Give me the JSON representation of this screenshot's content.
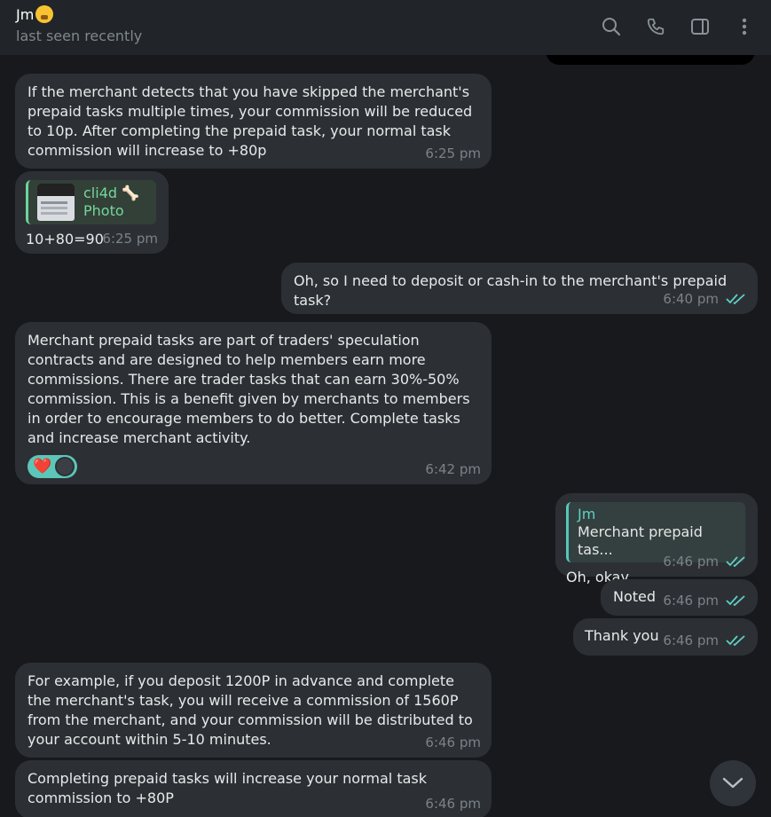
{
  "header": {
    "contact_name": "Jm",
    "status": "last seen recently",
    "icons": [
      "search-icon",
      "phone-icon",
      "sidebar-toggle-icon",
      "more-vertical-icon"
    ]
  },
  "colors": {
    "background": "#17191d",
    "header": "#212428",
    "bubble": "#2c3035",
    "read_check": "#5fd0c4",
    "reply_accent": "#6bd49a"
  },
  "messages": [
    {
      "direction": "incoming",
      "text": "If the merchant detects that you have skipped the merchant's prepaid tasks multiple times, your commission will be reduced to 10p. After completing the prepaid task, your normal task commission will increase to +80p",
      "time": "6:25 pm"
    },
    {
      "direction": "incoming",
      "reply": {
        "author": "cli4d 🦴",
        "preview": "Photo"
      },
      "text": "10+80=90",
      "time": "6:25 pm"
    },
    {
      "direction": "outgoing",
      "text": "Oh, so I need to deposit or cash-in to the merchant's prepaid task?",
      "time": "6:40 pm"
    },
    {
      "direction": "incoming",
      "text": "Merchant prepaid tasks are part of traders' speculation contracts and are designed to help members earn more commissions. There are trader tasks that can earn 30%-50% commission. This is a benefit given by merchants to members in order to encourage members to do better. Complete tasks and increase merchant activity.",
      "reaction": "❤️",
      "time": "6:42 pm"
    },
    {
      "direction": "outgoing",
      "reply": {
        "author": "Jm",
        "preview": "Merchant prepaid tas..."
      },
      "text": "Oh, okay",
      "time": "6:46 pm"
    },
    {
      "direction": "outgoing",
      "text": "Noted",
      "time": "6:46 pm"
    },
    {
      "direction": "outgoing",
      "text": "Thank you",
      "time": "6:46 pm"
    },
    {
      "direction": "incoming",
      "text": "For example, if you deposit 1200P in advance and complete the merchant's task, you will receive a commission of 1560P from the merchant, and your commission will be distributed to your account within 5-10 minutes.",
      "time": "6:46 pm"
    },
    {
      "direction": "incoming",
      "text": "Completing prepaid tasks will increase your normal task commission to +80P",
      "time": "6:46 pm"
    }
  ]
}
